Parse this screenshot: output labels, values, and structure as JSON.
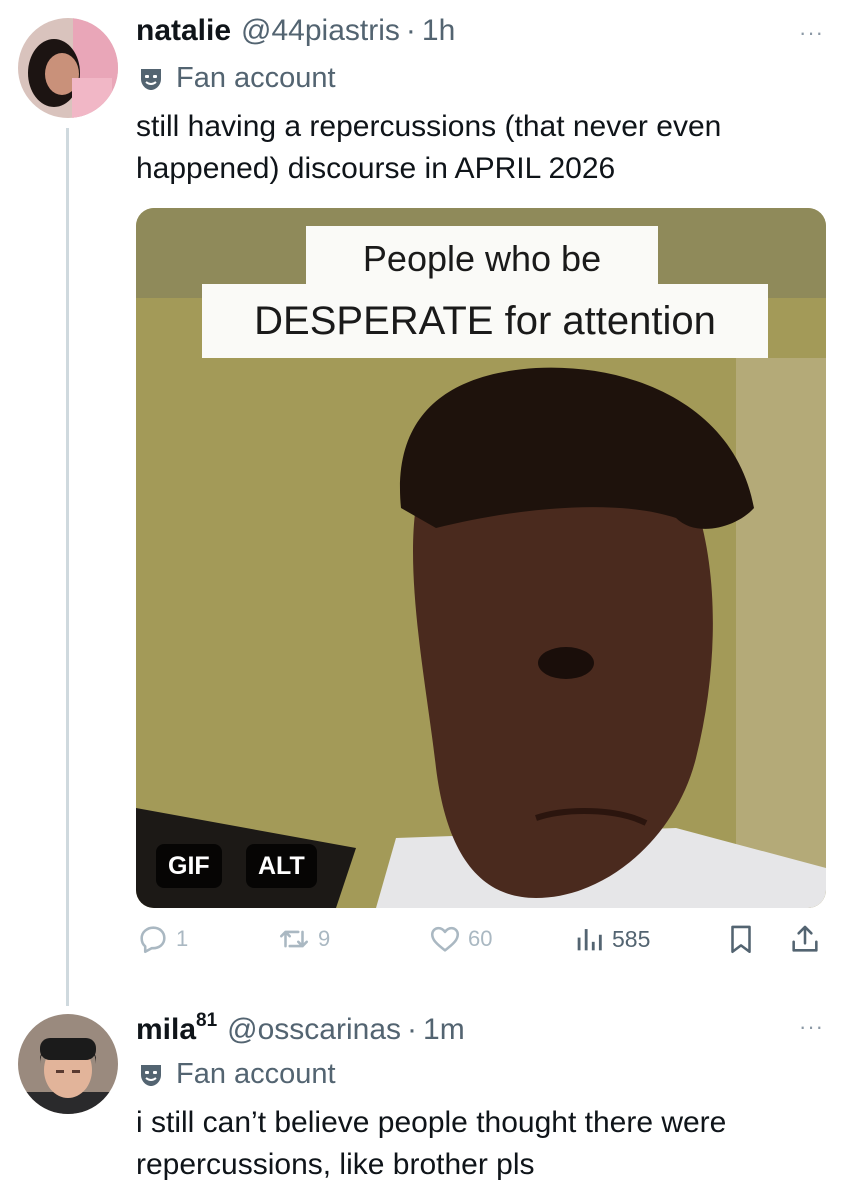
{
  "tweets": [
    {
      "display_name": "natalie",
      "handle": "@44piastris",
      "separator": "·",
      "time": "1h",
      "badge_label": "Fan account",
      "text": "still having a repercussions (that never even happened) discourse in APRIL 2026",
      "media": {
        "caption_line1": "People who be",
        "caption_line2": "DESPERATE for attention",
        "gif_label": "GIF",
        "alt_label": "ALT"
      },
      "actions": {
        "replies": "1",
        "reposts": "9",
        "likes": "60",
        "views": "585"
      }
    },
    {
      "display_name": "mila",
      "name_superscript": "81",
      "handle": "@osscarinas",
      "separator": "·",
      "time": "1m",
      "badge_label": "Fan account",
      "text": "i still can’t believe people thought there were repercussions, like brother pls"
    }
  ],
  "more_label": "···",
  "icons": {
    "fan_badge": "mask-icon",
    "reply": "reply-icon",
    "repost": "repost-icon",
    "like": "heart-icon",
    "views": "views-icon",
    "bookmark": "bookmark-icon",
    "share": "share-icon",
    "more": "more-icon"
  },
  "colors": {
    "text_primary": "#0f1419",
    "text_secondary": "#536471",
    "action_muted": "#aab8c2",
    "thread_line": "#cfd9de"
  }
}
